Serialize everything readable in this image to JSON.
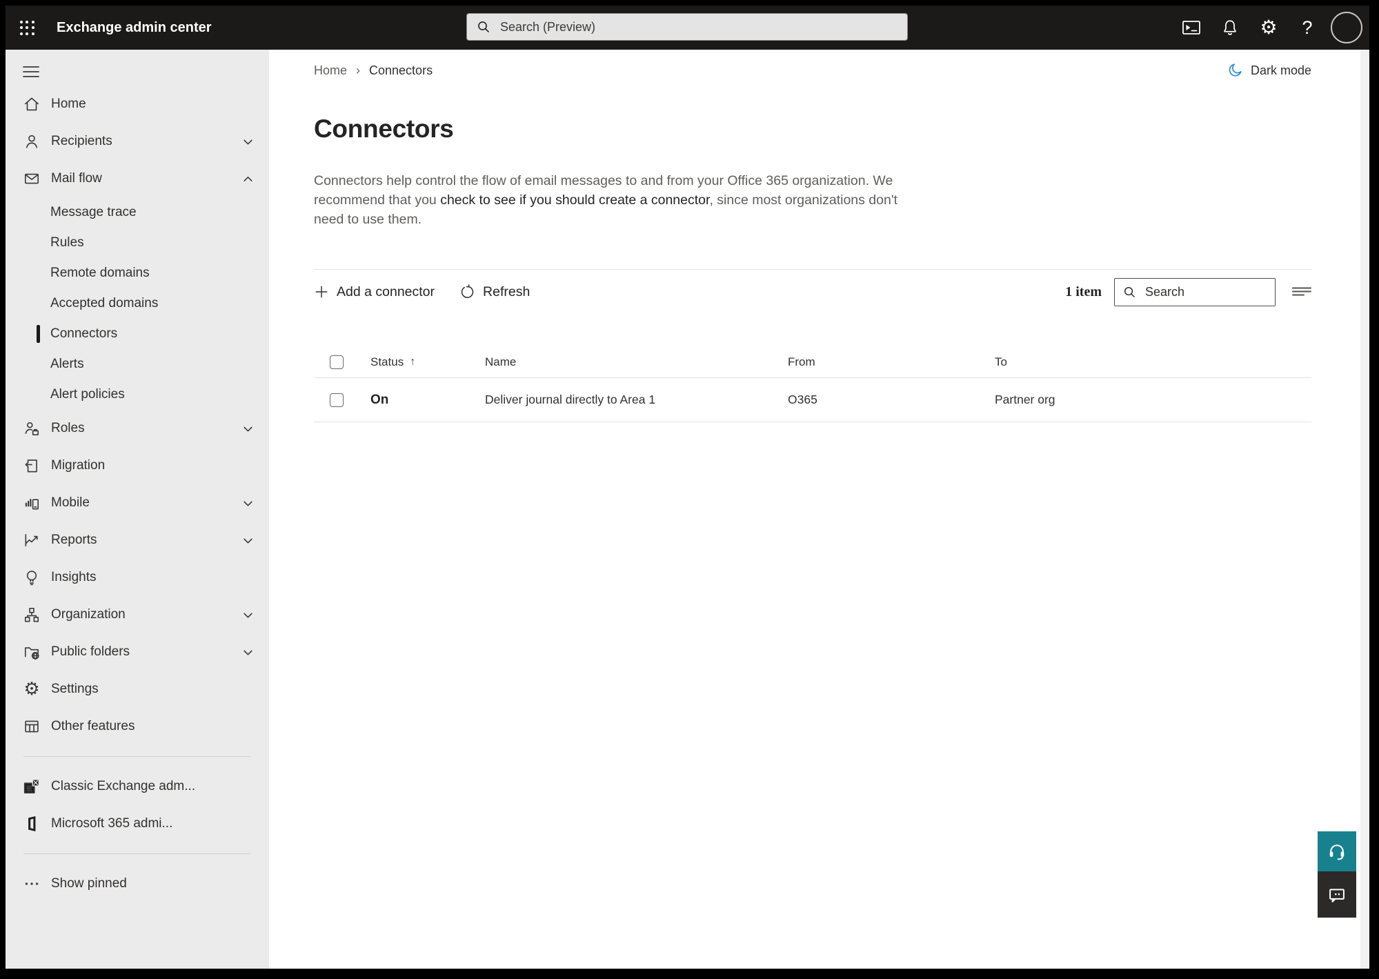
{
  "topbar": {
    "title": "Exchange admin center",
    "search_placeholder": "Search (Preview)"
  },
  "icons": {
    "gear": "⚙",
    "help": "?",
    "sort_ascending": "↑"
  },
  "breadcrumb": {
    "home": "Home",
    "separator": "›",
    "current": "Connectors"
  },
  "header": {
    "dark_mode_label": "Dark mode"
  },
  "page": {
    "title": "Connectors",
    "description_pre": "Connectors help control the flow of email messages to and from your Office 365 organization. We recommend that you ",
    "description_emphasis": "check to see if you should create a connector",
    "description_post": ", since most organizations don't need to use them."
  },
  "toolbar": {
    "add_label": "Add a connector",
    "refresh_label": "Refresh",
    "item_count": "1 item",
    "search_placeholder": "Search"
  },
  "table": {
    "columns": [
      "Status",
      "Name",
      "From",
      "To"
    ],
    "sort_column": "Status",
    "sort_direction": "ascending",
    "rows": [
      {
        "status": "On",
        "name": "Deliver journal directly to Area 1",
        "from": "O365",
        "to": "Partner org"
      }
    ]
  },
  "sidebar": {
    "selected": "Connectors",
    "items": [
      {
        "label": "Home"
      },
      {
        "label": "Recipients",
        "chevron": "down"
      },
      {
        "label": "Mail flow",
        "chevron": "up",
        "expanded": true
      },
      {
        "label": "Message trace",
        "sub": true
      },
      {
        "label": "Rules",
        "sub": true
      },
      {
        "label": "Remote domains",
        "sub": true
      },
      {
        "label": "Accepted domains",
        "sub": true
      },
      {
        "label": "Connectors",
        "sub": true,
        "selected": true
      },
      {
        "label": "Alerts",
        "sub": true
      },
      {
        "label": "Alert policies",
        "sub": true
      },
      {
        "label": "Roles",
        "chevron": "down"
      },
      {
        "label": "Migration"
      },
      {
        "label": "Mobile",
        "chevron": "down"
      },
      {
        "label": "Reports",
        "chevron": "down"
      },
      {
        "label": "Insights"
      },
      {
        "label": "Organization",
        "chevron": "down"
      },
      {
        "label": "Public folders",
        "chevron": "down"
      },
      {
        "label": "Settings"
      },
      {
        "label": "Other features"
      },
      {
        "label": "Classic Exchange adm..."
      },
      {
        "label": "Microsoft 365 admi..."
      },
      {
        "label": "Show pinned"
      }
    ]
  },
  "colors": {
    "topbar_bg": "#1b1a19",
    "sidebar_bg": "#ebebeb",
    "accent_teal": "#17818e",
    "feedback_dark": "#2b2a29",
    "dark_mode_moon": "#2b88d8",
    "text_primary": "#242424",
    "text_secondary": "#605e5c",
    "selection_indicator": "#1b1a19"
  }
}
